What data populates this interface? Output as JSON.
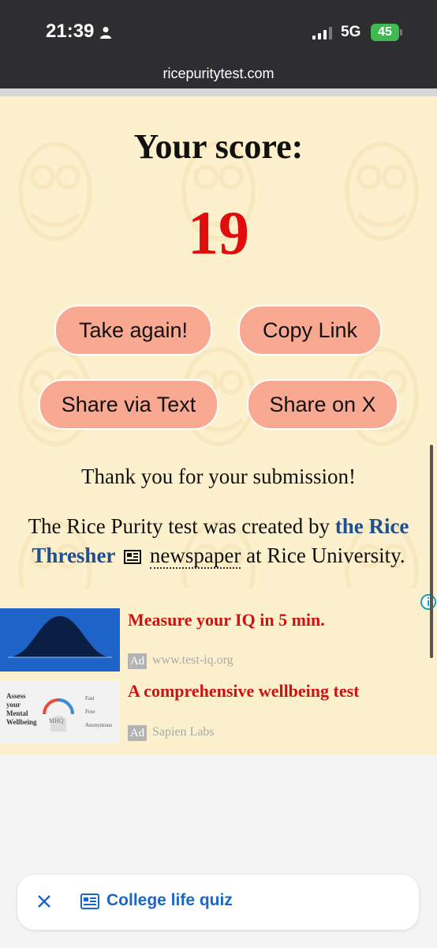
{
  "status_bar": {
    "time": "21:39",
    "network": "5G",
    "battery": "45"
  },
  "browser": {
    "url": "ricepuritytest.com"
  },
  "result": {
    "heading": "Your score:",
    "score": "19"
  },
  "buttons": {
    "take_again": "Take again!",
    "copy_link": "Copy Link",
    "share_text": "Share via Text",
    "share_x": "Share on X"
  },
  "message": {
    "thanks": "Thank you for your submission!",
    "credit_prefix": "The Rice Purity test was created by ",
    "credit_link": "the Rice Thresher",
    "credit_newspaper": "newspaper",
    "credit_suffix": " at Rice University."
  },
  "ads": [
    {
      "title": "Measure your IQ in 5 min.",
      "badge": "Ad",
      "source": "www.test-iq.org"
    },
    {
      "title": "A comprehensive wellbeing test",
      "badge": "Ad",
      "source": "Sapien Labs",
      "thumb_text": [
        "Assess",
        "your",
        "Mental",
        "Wellbeing"
      ],
      "thumb_logo": "MHQ",
      "thumb_features": [
        "Fast",
        "Free",
        "Anonymous"
      ]
    }
  ],
  "bottom_chip": {
    "label": "College life quiz"
  },
  "colors": {
    "page_bg": "#fdf0cc",
    "score_red": "#e10c0c",
    "button_bg": "#f9a892",
    "link_blue": "#1e4f8f",
    "chip_blue": "#1a67c9",
    "ad_title_red": "#d11111"
  }
}
